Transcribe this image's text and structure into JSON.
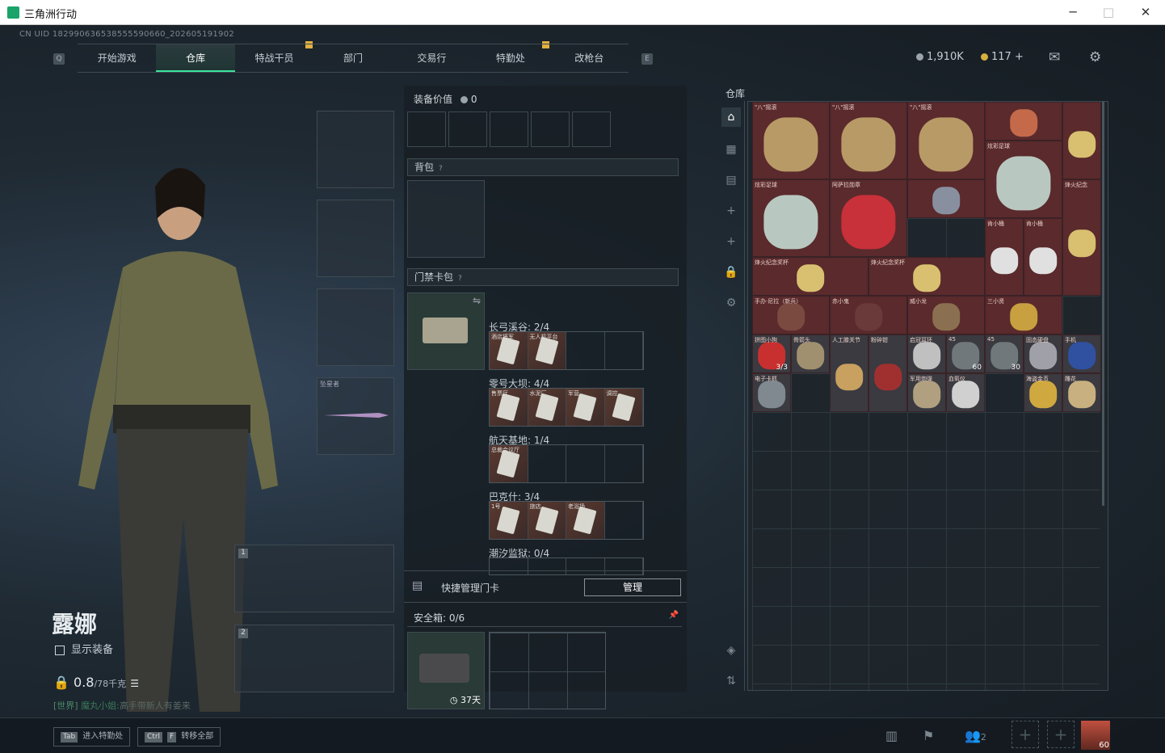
{
  "window": {
    "title": "三角洲行动",
    "min": "─",
    "max": "□",
    "close": "✕"
  },
  "uid": "CN UID 182990636538555590660_202605191902",
  "nav": {
    "key_left": "Q",
    "key_right": "E",
    "tabs": [
      "开始游戏",
      "仓库",
      "特战干员",
      "部门",
      "交易行",
      "特勤处",
      "改枪台"
    ]
  },
  "currency": {
    "coins": "1,910K",
    "tokens": "117 +"
  },
  "character": {
    "name": "露娜",
    "show_gear": "显示装备",
    "weight": "0.8",
    "weight_cap": "/78千克",
    "chat_channel": "[世界]",
    "chat_user": "魔丸小姐:",
    "chat_msg": "高手带新人有姜来"
  },
  "equip_slots": {
    "melee_label": "坠星者",
    "slot1": "1",
    "slot2": "2"
  },
  "center": {
    "value_label": "装备价值",
    "value": "0",
    "backpack": "背包",
    "help": "?",
    "keycard_bag": "门禁卡包",
    "maps": [
      {
        "name": "长弓溪谷: 2/4",
        "cards": [
          "酒店将军",
          "无人机平台",
          "",
          ""
        ]
      },
      {
        "name": "零号大坝: 4/4",
        "cards": [
          "售票厅",
          "水泥厂",
          "军营",
          "调控"
        ]
      },
      {
        "name": "航天基地: 1/4",
        "cards": [
          "总裁会议厅",
          "",
          "",
          ""
        ]
      },
      {
        "name": "巴克什: 3/4",
        "cards": [
          "1号",
          "旅店",
          "老浴场",
          ""
        ]
      },
      {
        "name": "潮汐监狱: 0/4",
        "cards": []
      }
    ],
    "quick_manage": "快捷管理门卡",
    "manage_btn": "管理",
    "safebox": "安全箱:",
    "safebox_val": "0/6",
    "safebox_days": "37天"
  },
  "warehouse": {
    "title": "仓库",
    "items": [
      {
        "label": "\"八\"摇滚",
        "color": "#b89a66"
      },
      {
        "label": "\"八\"摇滚",
        "color": "#b89a66"
      },
      {
        "label": "\"八\"摇滚",
        "color": "#b89a66"
      },
      {
        "label": "",
        "color": "#c46a4a"
      },
      {
        "label": "",
        "color": "#d8c070"
      },
      {
        "label": "炫彩足球",
        "color": "#b8c8c0"
      },
      {
        "label": "阿萨拉勋章",
        "color": "#c8303a"
      },
      {
        "label": "炫彩足球",
        "color": "#b8c8c0"
      },
      {
        "label": "",
        "color": "#8890a0"
      },
      {
        "label": "烽火纪念",
        "color": "#d8c070"
      },
      {
        "label": "烽火纪念奖杯",
        "color": "#d8c070"
      },
      {
        "label": "烽火纪念奖杯",
        "color": "#d8c070"
      },
      {
        "label": "肯小桶",
        "color": "#e0e0e0"
      },
      {
        "label": "肯小桶",
        "color": "#e0e0e0"
      },
      {
        "label": "手办·尼拉（新兵）",
        "color": "#7a4a40"
      },
      {
        "label": "赤小鬼",
        "color": "#6a3a3a"
      },
      {
        "label": "威小龙",
        "color": "#8a7050"
      },
      {
        "label": "三小贤",
        "color": "#c8a040"
      },
      {
        "label": "拼图小狗",
        "color": "#c83030",
        "count": "3/3"
      },
      {
        "label": "骨箭头",
        "color": "#a09070"
      },
      {
        "label": "人工膝关节",
        "color": "#c8a060"
      },
      {
        "label": "粉碎钳",
        "color": "#a03030"
      },
      {
        "label": "启冠耳环",
        "color": "#c0c0c0"
      },
      {
        "label": "45",
        "color": "#70787c",
        "count": "60"
      },
      {
        "label": "45",
        "color": "#70787c",
        "count": "30"
      },
      {
        "label": "固态硬盘",
        "color": "#a0a0a8"
      },
      {
        "label": "手机",
        "color": "#3050a0"
      },
      {
        "label": "电子卡抓",
        "color": "#808890"
      },
      {
        "label": "军用炮弹",
        "color": "#b0a080"
      },
      {
        "label": "血氧仪",
        "color": "#d0d0d0"
      },
      {
        "label": "海盗金币",
        "color": "#d0a840"
      },
      {
        "label": "雕花",
        "color": "#c8b080"
      }
    ]
  },
  "bottom": {
    "tab_key": "Tab",
    "tab_label": "进入特勤处",
    "ctrl_key": "Ctrl",
    "f_key": "F",
    "transfer_label": "转移全部",
    "party": "2",
    "level": "60"
  }
}
